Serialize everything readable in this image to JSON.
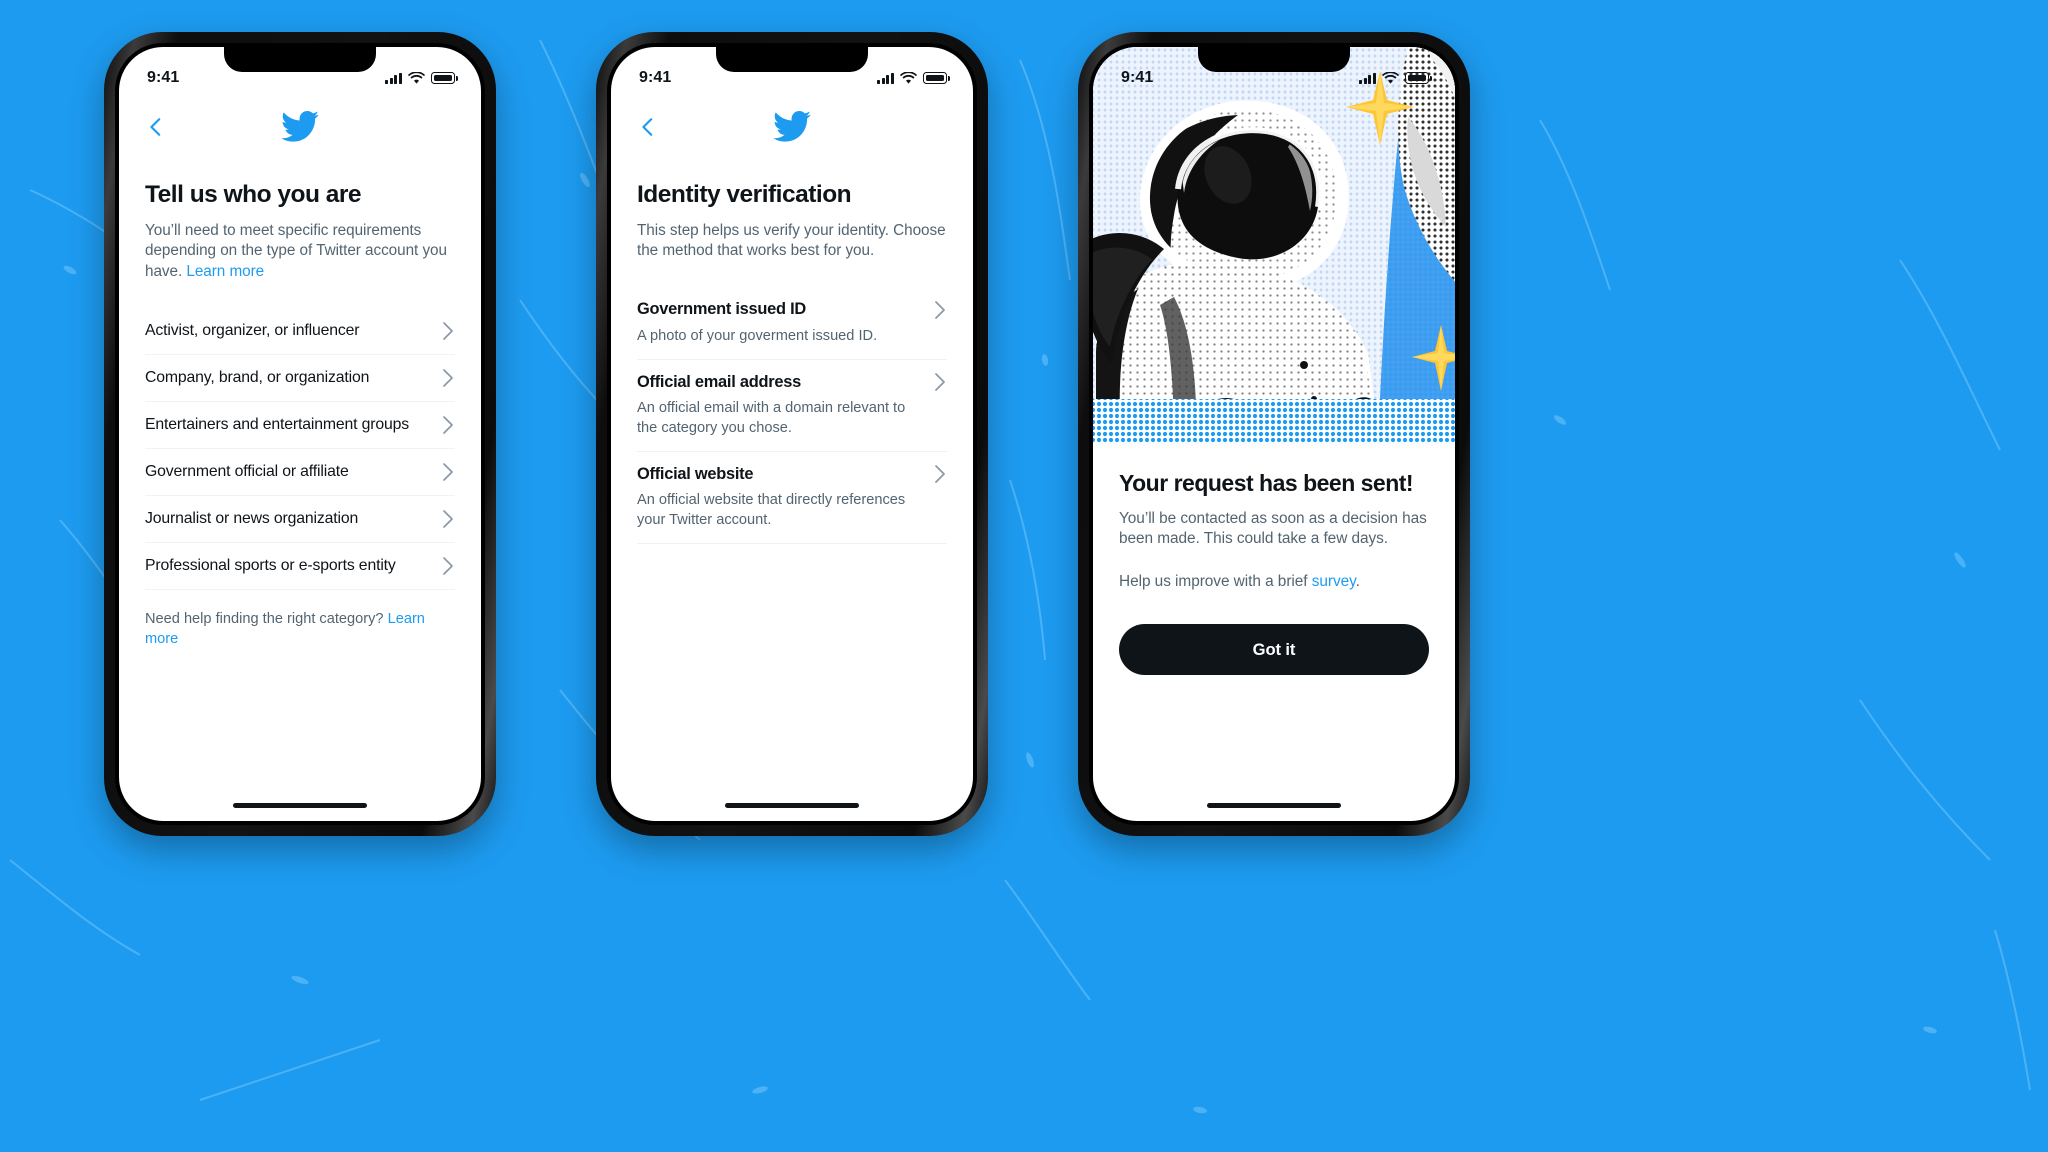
{
  "background": {
    "color": "#1d9bf0"
  },
  "accent": {
    "twitter_blue": "#1d9bf0",
    "text_primary": "#0f1419",
    "text_secondary": "#536471",
    "divider": "#eff3f4"
  },
  "phones": [
    {
      "name": "tell-us-who-you-are",
      "status_bar": {
        "time": "9:41"
      },
      "nav": {
        "back_icon": "chevron-left-icon",
        "logo_icon": "twitter-bird-icon"
      },
      "heading": "Tell us who you are",
      "subtext": "You’ll need to meet specific requirements depending on the type of Twitter account you have. ",
      "subtext_link": "Learn more",
      "categories": [
        "Activist, organizer, or influencer",
        "Company, brand, or organization",
        "Entertainers and entertainment groups",
        "Government official or affiliate",
        "Journalist or news organization",
        "Professional sports or e-sports entity"
      ],
      "helper_text": "Need help finding the right category? ",
      "helper_link": "Learn more"
    },
    {
      "name": "identity-verification",
      "status_bar": {
        "time": "9:41"
      },
      "nav": {
        "back_icon": "chevron-left-icon",
        "logo_icon": "twitter-bird-icon"
      },
      "heading": "Identity verification",
      "subtext": "This step helps us verify your identity. Choose the method that works best for you.",
      "methods": [
        {
          "title": "Government issued ID",
          "desc": "A photo of your goverment issued ID."
        },
        {
          "title": "Official email address",
          "desc": "An official email with a domain relevant to the category you chose."
        },
        {
          "title": "Official website",
          "desc": "An official website that directly references your Twitter account."
        }
      ]
    },
    {
      "name": "request-sent",
      "status_bar": {
        "time": "9:41"
      },
      "hero": {
        "alt": "astronaut-halftone-illustration"
      },
      "heading": "Your request has been sent!",
      "paragraph1": "You’ll be contacted as soon as a decision has been made. This could take a few days.",
      "paragraph2_before": "Help us improve with a brief ",
      "paragraph2_link": "survey",
      "paragraph2_after": ".",
      "cta_label": "Got it"
    }
  ]
}
